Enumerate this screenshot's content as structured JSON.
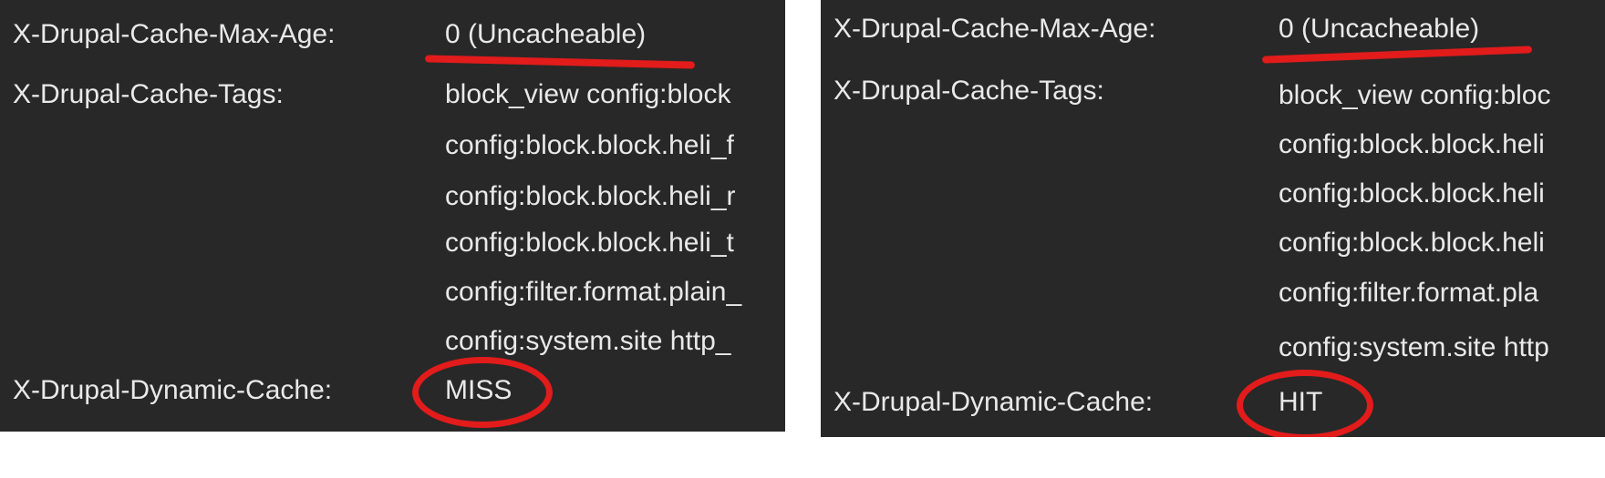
{
  "panels": [
    {
      "max_age_label": "X-Drupal-Cache-Max-Age:",
      "max_age_value": "0 (Uncacheable)",
      "tags_label": "X-Drupal-Cache-Tags:",
      "tags_lines": [
        "block_view config:block",
        "config:block.block.heli_f",
        "config:block.block.heli_r",
        "config:block.block.heli_t",
        "config:filter.format.plain_",
        "config:system.site http_"
      ],
      "dynamic_cache_label": "X-Drupal-Dynamic-Cache:",
      "dynamic_cache_value": "MISS"
    },
    {
      "max_age_label": "X-Drupal-Cache-Max-Age:",
      "max_age_value": "0 (Uncacheable)",
      "tags_label": "X-Drupal-Cache-Tags:",
      "tags_lines": [
        "block_view config:bloc",
        "config:block.block.heli",
        "config:block.block.heli",
        "config:block.block.heli",
        "config:filter.format.pla",
        "config:system.site http"
      ],
      "dynamic_cache_label": "X-Drupal-Dynamic-Cache:",
      "dynamic_cache_value": "HIT"
    }
  ],
  "colors": {
    "panel_background": "#282828",
    "text": "#e9e9e9",
    "annotation_red": "#e21b1b",
    "page_background": "#ffffff"
  }
}
